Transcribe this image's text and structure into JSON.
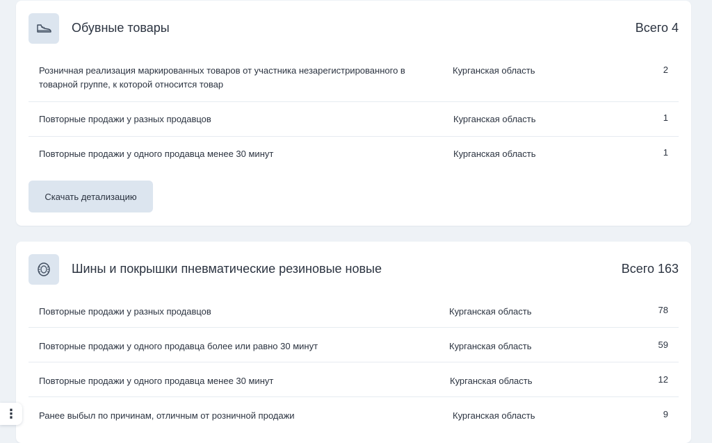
{
  "categories": [
    {
      "icon": "shoe-icon",
      "title": "Обувные товары",
      "total": "Всего 4",
      "rows": [
        {
          "reason": "Розничная реализация маркированных товаров от участника незарегистрированного в товарной группе, к которой относится товар",
          "region": "Курганская область",
          "count": "2"
        },
        {
          "reason": "Повторные продажи у разных продавцов",
          "region": "Курганская область",
          "count": "1"
        },
        {
          "reason": "Повторные продажи у одного продавца менее 30 минут",
          "region": "Курганская область",
          "count": "1"
        }
      ],
      "download_label": "Скачать детализацию"
    },
    {
      "icon": "tire-icon",
      "title": "Шины и покрышки пневматические резиновые новые",
      "total": "Всего 163",
      "rows": [
        {
          "reason": "Повторные продажи у разных продавцов",
          "region": "Курганская область",
          "count": "78"
        },
        {
          "reason": "Повторные продажи у одного продавца более или равно 30 минут",
          "region": "Курганская область",
          "count": "59"
        },
        {
          "reason": "Повторные продажи у одного продавца менее 30 минут",
          "region": "Курганская область",
          "count": "12"
        },
        {
          "reason": "Ранее выбыл по причинам, отличным от розничной продажи",
          "region": "Курганская область",
          "count": "9"
        }
      ]
    }
  ],
  "floating_menu": {
    "icon": "more-vertical-icon",
    "glyph": "⋮"
  }
}
